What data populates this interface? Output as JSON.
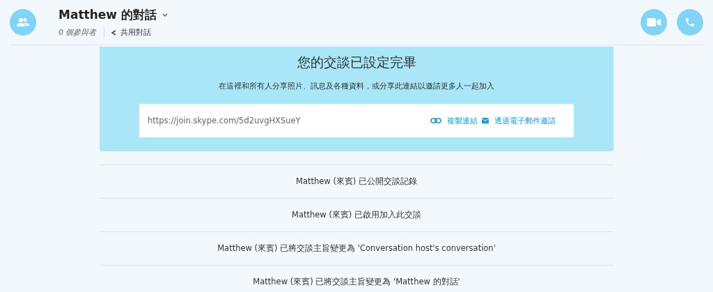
{
  "header": {
    "title": "Matthew 的對話",
    "participants": "0 個參與者",
    "share": "共用對話"
  },
  "banner": {
    "title": "您的交談已設定完畢",
    "subtitle": "在這裡和所有人分享照片、訊息及各種資料，或分享此連結以邀請更多人一起加入",
    "link": "https://join.skype.com/5d2uvgHXSueY",
    "copy": "複製連結",
    "email": "透過電子郵件邀請"
  },
  "events": [
    "Matthew (來賓) 已公開交談記錄",
    "Matthew (來賓) 已啟用加入此交談",
    "Matthew (來賓) 已將交談主旨變更為 'Conversation host's conversation'",
    "Matthew (來賓) 已將交談主旨變更為 'Matthew 的對話'"
  ]
}
